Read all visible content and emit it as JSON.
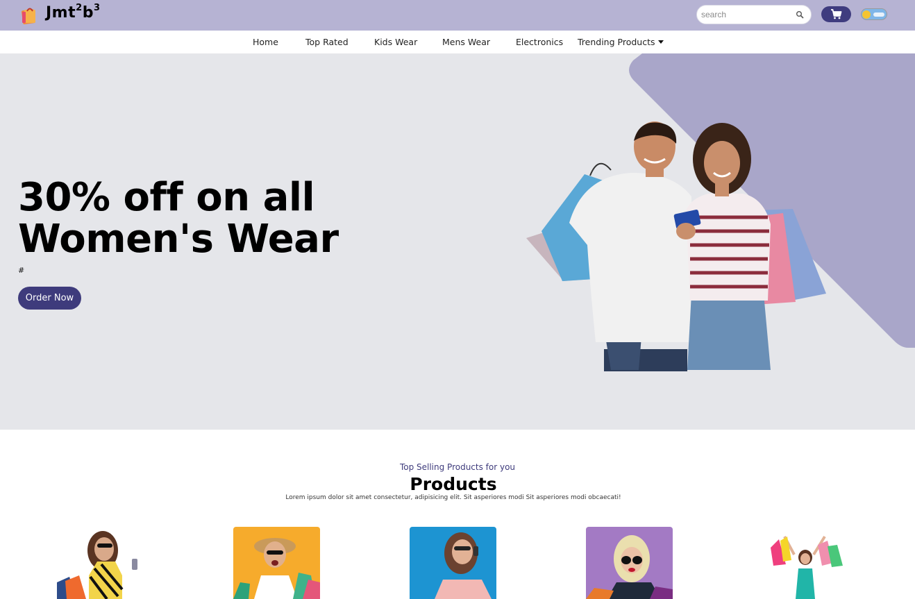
{
  "brand": {
    "name": "Jmt",
    "sup1": "2",
    "mid": "b",
    "sup2": "3"
  },
  "search": {
    "placeholder": "search"
  },
  "nav": {
    "items": [
      "Home",
      "Top Rated",
      "Kids Wear",
      "Mens Wear",
      "Electronics"
    ],
    "dropdown_label": "Trending Products"
  },
  "hero": {
    "title_line1": "30% off on all",
    "title_line2": "Women's Wear",
    "subtitle": "#",
    "cta_label": "Order Now"
  },
  "products": {
    "kicker": "Top Selling Products for you",
    "title": "Products",
    "description": "Lorem ipsum dolor sit amet consectetur, adipisicing elit. Sit asperiores modi Sit asperiores modi obcaecati!"
  },
  "colors": {
    "topbar": "#b6b3d3",
    "accent": "#3e3b7c",
    "hero_bg": "#e5e6ea",
    "hero_shape": "#a9a6c9"
  }
}
